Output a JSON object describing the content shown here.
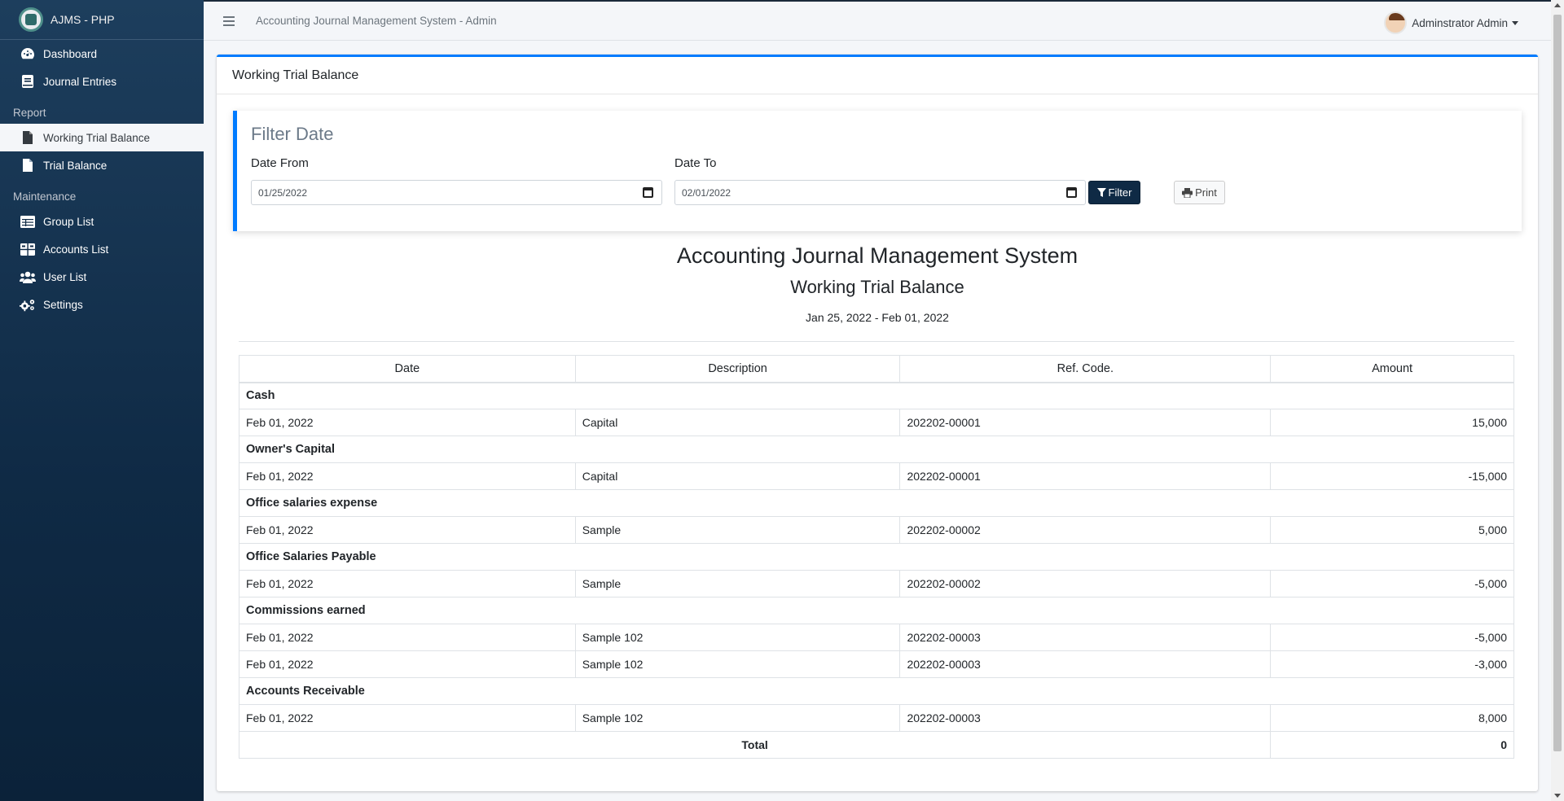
{
  "app": {
    "brand": "AJMS - PHP",
    "system_title": "Accounting Journal Management System - Admin"
  },
  "user": {
    "name": "Adminstrator Admin"
  },
  "sidebar": {
    "items": [
      {
        "label": "Dashboard",
        "icon": "dashboard-icon"
      },
      {
        "label": "Journal Entries",
        "icon": "book-icon"
      }
    ],
    "report_header": "Report",
    "report_items": [
      {
        "label": "Working Trial Balance",
        "icon": "file-icon",
        "active": true
      },
      {
        "label": "Trial Balance",
        "icon": "file-icon"
      }
    ],
    "maintenance_header": "Maintenance",
    "maintenance_items": [
      {
        "label": "Group List",
        "icon": "table-icon"
      },
      {
        "label": "Accounts List",
        "icon": "th-large-icon"
      },
      {
        "label": "User List",
        "icon": "users-icon"
      },
      {
        "label": "Settings",
        "icon": "cogs-icon"
      }
    ]
  },
  "card": {
    "title": "Working Trial Balance"
  },
  "filter": {
    "title": "Filter Date",
    "date_from_label": "Date From",
    "date_from_value": "01/25/2022",
    "date_to_label": "Date To",
    "date_to_value": "02/01/2022",
    "filter_button": "Filter",
    "print_button": "Print"
  },
  "report": {
    "system_name": "Accounting Journal Management System",
    "report_name": "Working Trial Balance",
    "date_range": "Jan 25, 2022 - Feb 01, 2022",
    "columns": [
      "Date",
      "Description",
      "Ref. Code.",
      "Amount"
    ],
    "rows": [
      {
        "group": "Cash"
      },
      {
        "date": "Feb 01, 2022",
        "description": "Capital",
        "ref": "202202-00001",
        "amount": "15,000"
      },
      {
        "group": "Owner's Capital"
      },
      {
        "date": "Feb 01, 2022",
        "description": "Capital",
        "ref": "202202-00001",
        "amount": "-15,000"
      },
      {
        "group": "Office salaries expense"
      },
      {
        "date": "Feb 01, 2022",
        "description": "Sample",
        "ref": "202202-00002",
        "amount": "5,000"
      },
      {
        "group": "Office Salaries Payable"
      },
      {
        "date": "Feb 01, 2022",
        "description": "Sample",
        "ref": "202202-00002",
        "amount": "-5,000"
      },
      {
        "group": "Commissions earned"
      },
      {
        "date": "Feb 01, 2022",
        "description": "Sample 102",
        "ref": "202202-00003",
        "amount": "-5,000"
      },
      {
        "date": "Feb 01, 2022",
        "description": "Sample 102",
        "ref": "202202-00003",
        "amount": "-3,000"
      },
      {
        "group": "Accounts Receivable"
      },
      {
        "date": "Feb 01, 2022",
        "description": "Sample 102",
        "ref": "202202-00003",
        "amount": "8,000"
      }
    ],
    "total_label": "Total",
    "total_value": "0"
  },
  "colors": {
    "accent": "#007bff",
    "sidebar": "#0f2a45",
    "filter_button": "#0f2a45"
  }
}
